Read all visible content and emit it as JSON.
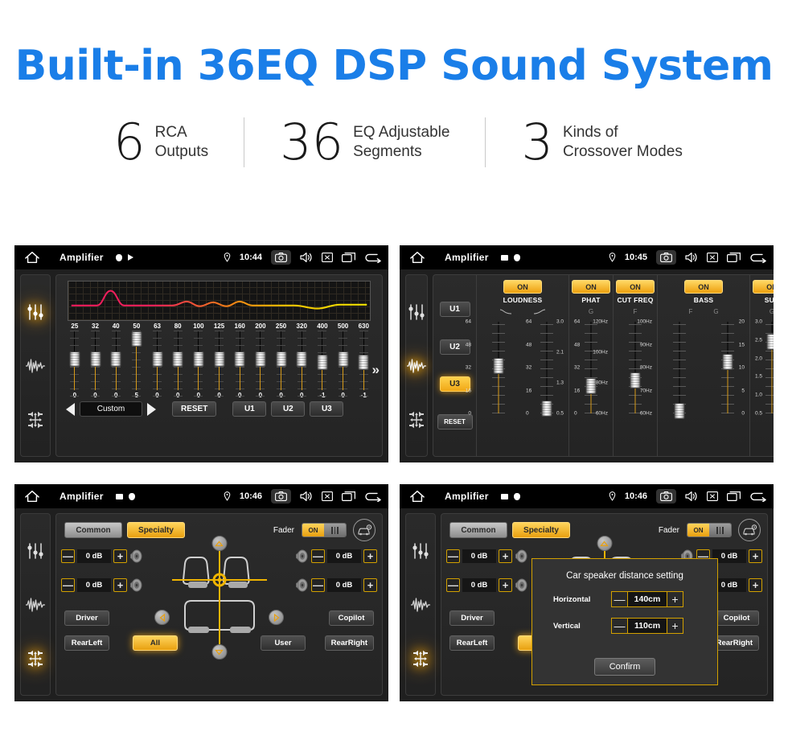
{
  "header": {
    "title": "Built-in 36EQ DSP Sound System",
    "title_color": "#1a7ee8",
    "stats": [
      {
        "number": "6",
        "line1": "RCA",
        "line2": "Outputs"
      },
      {
        "number": "36",
        "line1": "EQ Adjustable",
        "line2": "Segments"
      },
      {
        "number": "3",
        "line1": "Kinds of",
        "line2": "Crossover Modes"
      }
    ]
  },
  "accent_color": "#e8a010",
  "panels": {
    "eq": {
      "statusbar": {
        "app_title": "Amplifier",
        "time": "10:44",
        "icons": [
          "home-icon",
          "record-dot-icon",
          "play-triangle-icon",
          "location-pin-icon",
          "camera-icon",
          "volume-icon",
          "close-x-icon",
          "recent-apps-icon",
          "back-arrow-icon"
        ]
      },
      "rail": [
        "equalizer-icon",
        "waveform-icon",
        "balance-icon"
      ],
      "rail_active_index": 0,
      "frequencies": [
        "25",
        "32",
        "40",
        "50",
        "63",
        "80",
        "100",
        "125",
        "160",
        "200",
        "250",
        "320",
        "400",
        "500",
        "630"
      ],
      "gains": [
        "0",
        "0",
        "0",
        "5",
        "0",
        "0",
        "0",
        "0",
        "0",
        "0",
        "0",
        "0",
        "-1",
        "0",
        "-1"
      ],
      "next_chevron": "»",
      "preset_name": "Custom",
      "prev_label": "◀",
      "next_label": "▶",
      "reset_label": "RESET",
      "user_presets": [
        "U1",
        "U2",
        "U3"
      ]
    },
    "crossover": {
      "statusbar": {
        "app_title": "Amplifier",
        "time": "10:45"
      },
      "rail_active_index": 1,
      "presets": [
        "U1",
        "U2",
        "U3"
      ],
      "preset_active": "U3",
      "reset_label": "RESET",
      "columns": [
        {
          "name": "LOUDNESS",
          "on_label": "ON",
          "subs": [
            "curve-down-icon",
            "curve-up-icon"
          ],
          "slots": [
            {
              "scale_left": [
                "64",
                "48",
                "32",
                "16",
                "0"
              ],
              "scale_right": [
                "64",
                "48",
                "32",
                "16",
                "0"
              ],
              "value_pct": 52
            },
            {
              "scale_left": [],
              "scale_right": [
                "64",
                "48",
                "32",
                "16",
                "0"
              ],
              "value_pct": 5
            }
          ]
        },
        {
          "name": "PHAT",
          "on_label": "ON",
          "subs": [
            "G"
          ],
          "slots": [
            {
              "scale_left": [
                "3.0",
                "2.1",
                "1.3",
                "0.5"
              ],
              "scale_right": [],
              "value_pct": 30
            }
          ]
        },
        {
          "name": "CUT FREQ",
          "on_label": "ON",
          "subs": [
            "F"
          ],
          "slots": [
            {
              "scale_left": [
                "120Hz",
                "100Hz",
                "80Hz",
                "60Hz"
              ],
              "scale_right": [],
              "value_pct": 36
            }
          ]
        },
        {
          "name": "BASS",
          "on_label": "ON",
          "subs": [
            "F",
            "G"
          ],
          "slots": [
            {
              "scale_left": [
                "100Hz",
                "90Hz",
                "80Hz",
                "70Hz",
                "60Hz"
              ],
              "scale_right": [],
              "value_pct": 3
            },
            {
              "scale_left": [],
              "scale_right": [
                "3.0",
                "2.5",
                "2.0",
                "1.5",
                "1.0",
                "0.5"
              ],
              "value_pct": 56
            }
          ]
        },
        {
          "name": "SUB",
          "on_label": "ON",
          "subs": [
            "G"
          ],
          "slots": [
            {
              "scale_left": [
                "20",
                "15",
                "10",
                "5",
                "0"
              ],
              "scale_right": [],
              "value_pct": 78
            }
          ]
        }
      ]
    },
    "fader": {
      "statusbar": {
        "app_title": "Amplifier",
        "time": "10:46"
      },
      "rail_active_index": 2,
      "tabs": [
        {
          "label": "Common",
          "selected": false
        },
        {
          "label": "Specialty",
          "selected": true
        }
      ],
      "fader_label": "Fader",
      "fader_toggle": "ON",
      "car_settings_icon": "car-settings-icon",
      "channels": [
        {
          "position": "front-left",
          "value": "0 dB"
        },
        {
          "position": "front-right",
          "value": "0 dB"
        },
        {
          "position": "rear-left",
          "value": "0 dB"
        },
        {
          "position": "rear-right",
          "value": "0 dB"
        }
      ],
      "minus_label": "—",
      "plus_label": "+",
      "seat_buttons": [
        {
          "label": "Driver",
          "selected": false
        },
        {
          "label": "Copilot",
          "selected": false
        },
        {
          "label": "RearLeft",
          "selected": false
        },
        {
          "label": "All",
          "selected": true
        },
        {
          "label": "User",
          "selected": false
        },
        {
          "label": "RearRight",
          "selected": false
        }
      ]
    },
    "fader_modal": {
      "statusbar": {
        "app_title": "Amplifier",
        "time": "10:46"
      },
      "dialog": {
        "title": "Car speaker distance setting",
        "rows": [
          {
            "label": "Horizontal",
            "value": "140cm"
          },
          {
            "label": "Vertical",
            "value": "110cm"
          }
        ],
        "minus_label": "—",
        "plus_label": "+",
        "confirm_label": "Confirm"
      }
    }
  }
}
